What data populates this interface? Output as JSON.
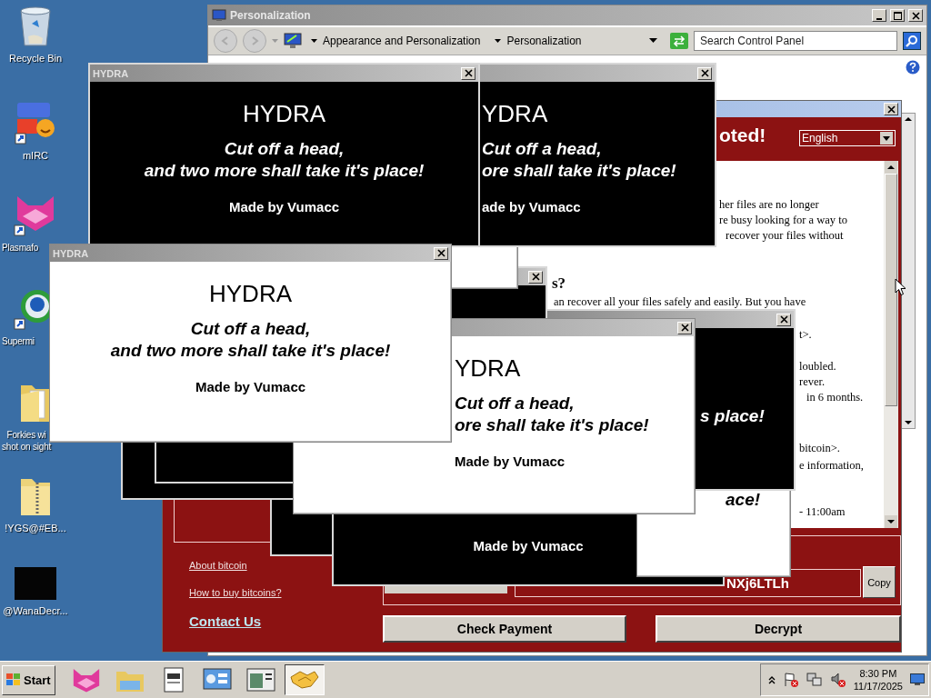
{
  "desktop_icons": [
    {
      "kind": "recycle",
      "label": "Recycle Bin"
    },
    {
      "kind": "mirc",
      "label": "mIRC"
    },
    {
      "kind": "plasma",
      "label": "Plasmafo"
    },
    {
      "kind": "globe",
      "label": "Supermi"
    },
    {
      "kind": "folder",
      "label": "Forkies wi\nshot on sight"
    },
    {
      "kind": "zip",
      "label": "!YGS@#EB..."
    },
    {
      "kind": "blank",
      "label": "@WanaDecr..."
    }
  ],
  "personalization_window": {
    "title": "Personalization",
    "breadcrumb": [
      "Appearance and Personalization",
      "Personalization"
    ],
    "search": {
      "placeholder": "Search Control Panel"
    }
  },
  "ransom_window": {
    "heading": "oted!",
    "language": "English",
    "text_lines": [
      {
        "kind": "text",
        "text": "her files are no longer"
      },
      {
        "kind": "text",
        "text": "re busy looking for a way to"
      },
      {
        "kind": "text",
        "text": "recover your files without"
      },
      {
        "kind": "heading",
        "text": "s?"
      },
      {
        "kind": "text",
        "text": "an recover all your files safely and easily. But you have"
      },
      {
        "kind": "text",
        "text": "t>."
      },
      {
        "kind": "text",
        "text": "loubled."
      },
      {
        "kind": "text",
        "text": "rever."
      },
      {
        "kind": "text",
        "text": "in 6 months."
      },
      {
        "kind": "text",
        "text": "bitcoin>."
      },
      {
        "kind": "text",
        "text": "e information,"
      },
      {
        "kind": "text",
        "text": "- 11:00am"
      }
    ],
    "links": [
      "About bitcoin",
      "How to buy bitcoins?"
    ],
    "contact": "Contact Us",
    "address": "NXj6LTLh",
    "copy_button": "Copy",
    "buttons": [
      "Check Payment",
      "Decrypt"
    ]
  },
  "hydra_windows": [
    {
      "dark": true,
      "close": false
    },
    {
      "dark": true,
      "close": false
    },
    {
      "dark": true,
      "close": false
    },
    {
      "dark": true,
      "close": false,
      "lines": [
        {
          "kind": "credit",
          "text": "Made by Vumacc"
        }
      ]
    },
    {
      "dark": false,
      "close": false,
      "lines": [
        {
          "kind": "slogan",
          "text": "ace!"
        }
      ]
    },
    {
      "dark": true,
      "close": true,
      "lines": [
        {
          "kind": "slogan",
          "text": "s place!"
        }
      ]
    },
    {
      "dark": true,
      "close": true
    },
    {
      "dark": false,
      "close": false
    },
    {
      "dark": true,
      "close": true,
      "lines": [
        {
          "kind": "title",
          "text": "YDRA"
        },
        {
          "kind": "slogan",
          "text": "Cut off a head,"
        },
        {
          "kind": "slogan",
          "text": "ore shall take it's place!"
        },
        {
          "kind": "credit",
          "text": "ade by Vumacc"
        }
      ]
    },
    {
      "dark": false,
      "close": true,
      "lines": [
        {
          "kind": "title",
          "text": "YDRA"
        },
        {
          "kind": "slogan",
          "text": "Cut off a head,"
        },
        {
          "kind": "slogan",
          "text": "ore shall take it's place!"
        },
        {
          "kind": "credit",
          "text": "Made by Vumacc"
        }
      ]
    },
    {
      "dark": true,
      "close": true,
      "title": "HYDRA",
      "lines": [
        {
          "kind": "title",
          "text": "HYDRA"
        },
        {
          "kind": "slogan",
          "text": "Cut off a head,"
        },
        {
          "kind": "slogan",
          "text": "and two more shall take it's place!"
        },
        {
          "kind": "credit",
          "text": "Made by Vumacc"
        }
      ]
    },
    {
      "dark": false,
      "close": true,
      "title": "HYDRA",
      "lines": [
        {
          "kind": "title",
          "text": "HYDRA"
        },
        {
          "kind": "slogan",
          "text": "Cut off a head,"
        },
        {
          "kind": "slogan",
          "text": "and two more shall take it's place!"
        },
        {
          "kind": "credit",
          "text": "Made by Vumacc"
        }
      ]
    }
  ],
  "taskbar": {
    "start": "Start",
    "apps": [
      {
        "kind": "plasma",
        "selected": false
      },
      {
        "kind": "explorer",
        "selected": false
      },
      {
        "kind": "document",
        "selected": false
      },
      {
        "kind": "control-panel",
        "selected": false
      },
      {
        "kind": "window",
        "selected": false
      },
      {
        "kind": "handshake",
        "selected": true
      }
    ],
    "clock": {
      "time": "8:30 PM",
      "date": "11/17/2025"
    }
  }
}
